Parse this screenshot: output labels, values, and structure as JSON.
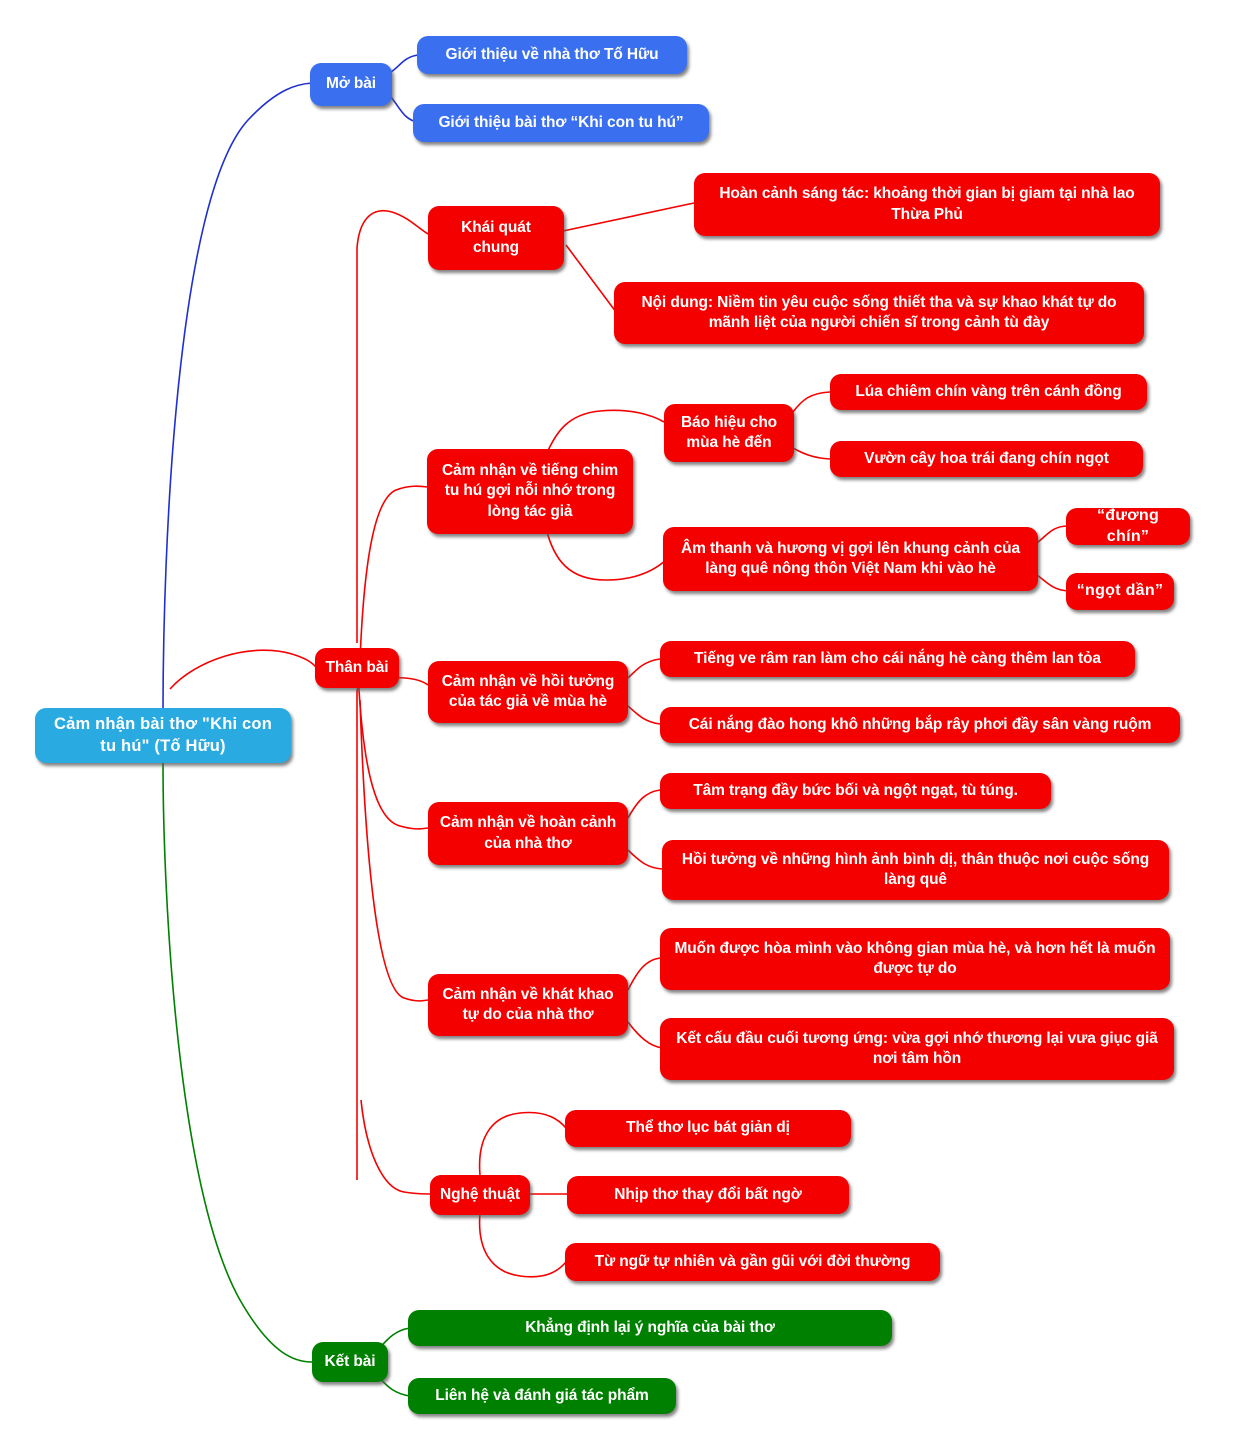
{
  "document": {
    "type": "mind-map",
    "title": "Cảm nhận bài thơ \"Khi con tu hú\" (Tố Hữu)",
    "background_color": "#ffffff"
  },
  "colors": {
    "root": "#29ABE2",
    "branch_open": "#3A6FEF",
    "branch_body": "#F40000",
    "branch_close": "#008000",
    "text": "#ffffff"
  },
  "root": {
    "label": "Cảm nhận bài thơ \"Khi con tu hú\" (Tố Hữu)"
  },
  "branches": [
    {
      "id": "mo-bai",
      "label": "Mở bài",
      "color": "#3A6FEF",
      "children": [
        {
          "label": "Giới thiệu về nhà thơ Tố Hữu"
        },
        {
          "label": "Giới thiệu bài thơ “Khi con tu hú”"
        }
      ]
    },
    {
      "id": "than-bai",
      "label": "Thân bài",
      "color": "#F40000",
      "children": [
        {
          "id": "khai-quat-chung",
          "label": "Khái quát chung",
          "children": [
            {
              "label": "Hoàn cảnh sáng tác: khoảng thời gian bị giam tại nhà lao Thừa Phủ"
            },
            {
              "label": "Nội dung: Niềm tin yêu cuộc sống thiết tha và sự khao khát tự do mãnh liệt của người chiến sĩ trong cảnh tù đày"
            }
          ]
        },
        {
          "id": "tieng-chim-tu-hu",
          "label": "Cảm nhận về tiếng chim tu hú gợi nỗi nhớ trong lòng tác giả",
          "children": [
            {
              "label": "Báo hiệu cho mùa hè đến",
              "children": [
                {
                  "label": "Lúa chiêm chín vàng trên cánh đồng"
                },
                {
                  "label": "Vườn cây hoa trái đang chín ngọt"
                }
              ]
            },
            {
              "label": "Âm thanh và hương vị gợi lên khung cảnh của làng quê nông thôn Việt Nam khi vào hè",
              "children": [
                {
                  "label": "“đương chín”"
                },
                {
                  "label": "“ngọt dần”"
                }
              ]
            }
          ]
        },
        {
          "id": "hoi-tuong",
          "label": "Cảm nhận về hồi tưởng của tác giả về mùa hè",
          "children": [
            {
              "label": "Tiếng ve râm ran làm cho cái nắng hè càng thêm lan tỏa"
            },
            {
              "label": "Cái nắng đào hong khô những bắp rây phơi đầy sân vàng ruộm"
            }
          ]
        },
        {
          "id": "hoan-canh-nha-tho",
          "label": "Cảm nhận về hoàn cảnh của nhà thơ",
          "children": [
            {
              "label": "Tâm trạng đầy bức bối và ngột ngạt, tù túng."
            },
            {
              "label": "Hồi tưởng về những hình ảnh bình dị, thân thuộc nơi cuộc sống làng quê"
            }
          ]
        },
        {
          "id": "khat-khao-tu-do",
          "label": "Cảm nhận về khát khao tự do của nhà thơ",
          "children": [
            {
              "label": "Muốn được hòa mình vào không gian mùa hè, và hơn hết là muốn được tự do"
            },
            {
              "label": "Kết cấu đầu cuối tương ứng: vừa gợi nhớ thương lại vưa giục giã nơi tâm hồn"
            }
          ]
        },
        {
          "id": "nghe-thuat",
          "label": "Nghệ thuật",
          "children": [
            {
              "label": "Thể thơ lục bát giản dị"
            },
            {
              "label": "Nhịp thơ thay đổi bất ngờ"
            },
            {
              "label": "Từ ngữ tự nhiên và gần gũi với đời thường"
            }
          ]
        }
      ]
    },
    {
      "id": "ket-bai",
      "label": "Kết bài",
      "color": "#008000",
      "children": [
        {
          "label": "Khẳng định lại ý nghĩa của bài thơ"
        },
        {
          "label": "Liên hệ và đánh giá tác phẩm"
        }
      ]
    }
  ],
  "nodes": {
    "root": {
      "label": "Cảm nhận bài thơ \"Khi con tu hú\" (Tố Hữu)"
    },
    "mo_bai": {
      "label": "Mở bài"
    },
    "mo_bai_1": {
      "label": "Giới thiệu về nhà thơ Tố Hữu"
    },
    "mo_bai_2": {
      "label": "Giới thiệu bài thơ “Khi con tu hú”"
    },
    "than_bai": {
      "label": "Thân bài"
    },
    "khai_quat": {
      "label": "Khái quát chung"
    },
    "khai_quat_1": {
      "label": "Hoàn cảnh sáng tác: khoảng thời gian bị giam tại nhà lao Thừa Phủ"
    },
    "khai_quat_2": {
      "label": "Nội dung: Niềm tin yêu cuộc sống thiết tha và sự khao khát tự do mãnh liệt của người chiến sĩ trong cảnh tù đày"
    },
    "tieng_chim": {
      "label": "Cảm nhận về tiếng chim tu hú gợi nỗi nhớ trong lòng tác giả"
    },
    "bao_hieu": {
      "label": "Báo hiệu cho mùa hè đến"
    },
    "bao_hieu_1": {
      "label": "Lúa chiêm chín vàng trên cánh đồng"
    },
    "bao_hieu_2": {
      "label": "Vườn cây hoa trái đang chín ngọt"
    },
    "am_thanh": {
      "label": "Âm thanh và hương vị gợi lên khung cảnh của làng quê nông thôn Việt Nam khi vào hè"
    },
    "am_thanh_1": {
      "label": "“đương chín”"
    },
    "am_thanh_2": {
      "label": "“ngọt dần”"
    },
    "hoi_tuong": {
      "label": "Cảm nhận về hồi tưởng của tác giả về mùa hè"
    },
    "hoi_tuong_1": {
      "label": "Tiếng ve râm ran làm cho cái nắng hè càng thêm lan tỏa"
    },
    "hoi_tuong_2": {
      "label": "Cái nắng đào hong khô những bắp rây phơi đầy sân vàng ruộm"
    },
    "hoan_canh": {
      "label": "Cảm nhận về hoàn cảnh của nhà thơ"
    },
    "hoan_canh_1": {
      "label": "Tâm trạng đầy bức bối và ngột ngạt, tù túng."
    },
    "hoan_canh_2": {
      "label": "Hồi tưởng về những hình ảnh bình dị, thân thuộc nơi cuộc sống làng quê"
    },
    "khat_khao": {
      "label": "Cảm nhận về khát khao tự do của nhà thơ"
    },
    "khat_khao_1": {
      "label": "Muốn được hòa mình vào không gian mùa hè, và hơn hết là muốn được tự do"
    },
    "khat_khao_2": {
      "label": "Kết cấu đầu cuối tương ứng: vừa gợi nhớ thương lại vưa giục giã nơi tâm hồn"
    },
    "nghe_thuat": {
      "label": "Nghệ thuật"
    },
    "nghe_thuat_1": {
      "label": "Thể thơ lục bát giản dị"
    },
    "nghe_thuat_2": {
      "label": "Nhịp thơ thay đổi bất ngờ"
    },
    "nghe_thuat_3": {
      "label": "Từ ngữ tự nhiên và gần gũi với đời thường"
    },
    "ket_bai": {
      "label": "Kết bài"
    },
    "ket_bai_1": {
      "label": "Khẳng định lại ý nghĩa của bài thơ"
    },
    "ket_bai_2": {
      "label": "Liên hệ và đánh giá tác phẩm"
    }
  }
}
